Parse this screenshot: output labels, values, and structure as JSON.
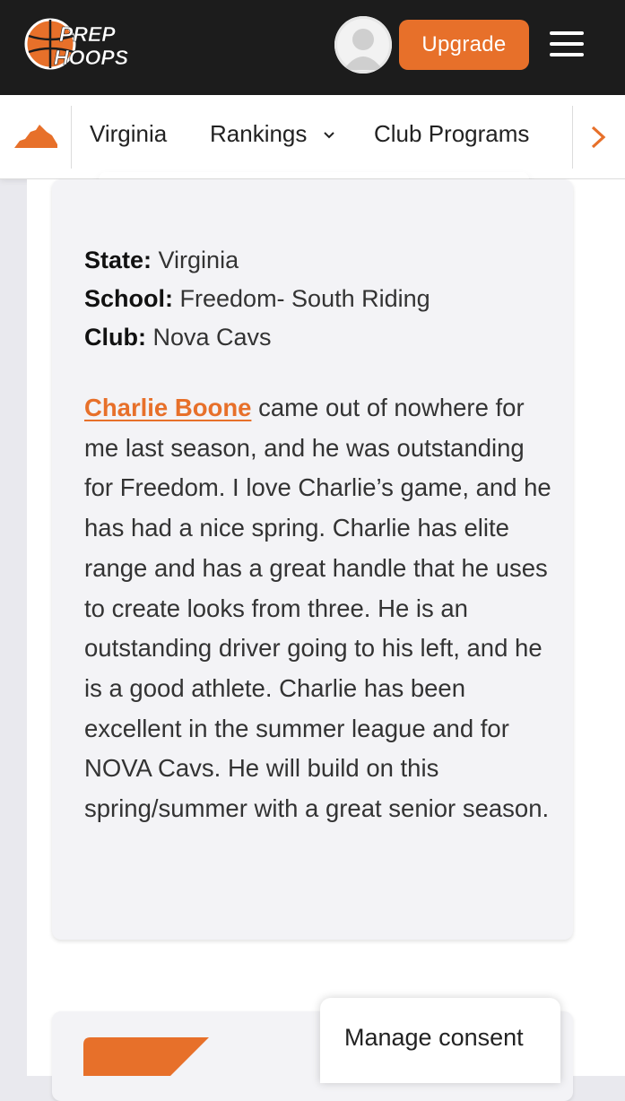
{
  "header": {
    "logo_line1": "PREP",
    "logo_line2": "HOOPS",
    "upgrade_label": "Upgrade"
  },
  "subnav": {
    "items": [
      {
        "label": "Virginia"
      },
      {
        "label": "Rankings"
      },
      {
        "label": "Club Programs"
      }
    ]
  },
  "profile": {
    "state_label": "State:",
    "state_value": "Virginia",
    "school_label": "School:",
    "school_value": "Freedom- South Riding",
    "club_label": "Club:",
    "club_value": "Nova Cavs",
    "player_link": "Charlie Boone",
    "bio_text": "came out of nowhere for me last season, and he was outstanding for Freedom. I love Charlie’s game, and he has had a nice spring. Charlie has elite range and has a great handle that he uses to create looks from three. He is an outstanding driver going to his left, and he is a good athlete. Charlie has been excellent in the summer league and for NOVA Cavs. He will build on this spring/summer with a great senior season."
  },
  "consent": {
    "label": "Manage consent"
  },
  "colors": {
    "brand_orange": "#e7702a",
    "header_bg": "#1c1c1c",
    "card_bg": "#f3f3f6"
  }
}
